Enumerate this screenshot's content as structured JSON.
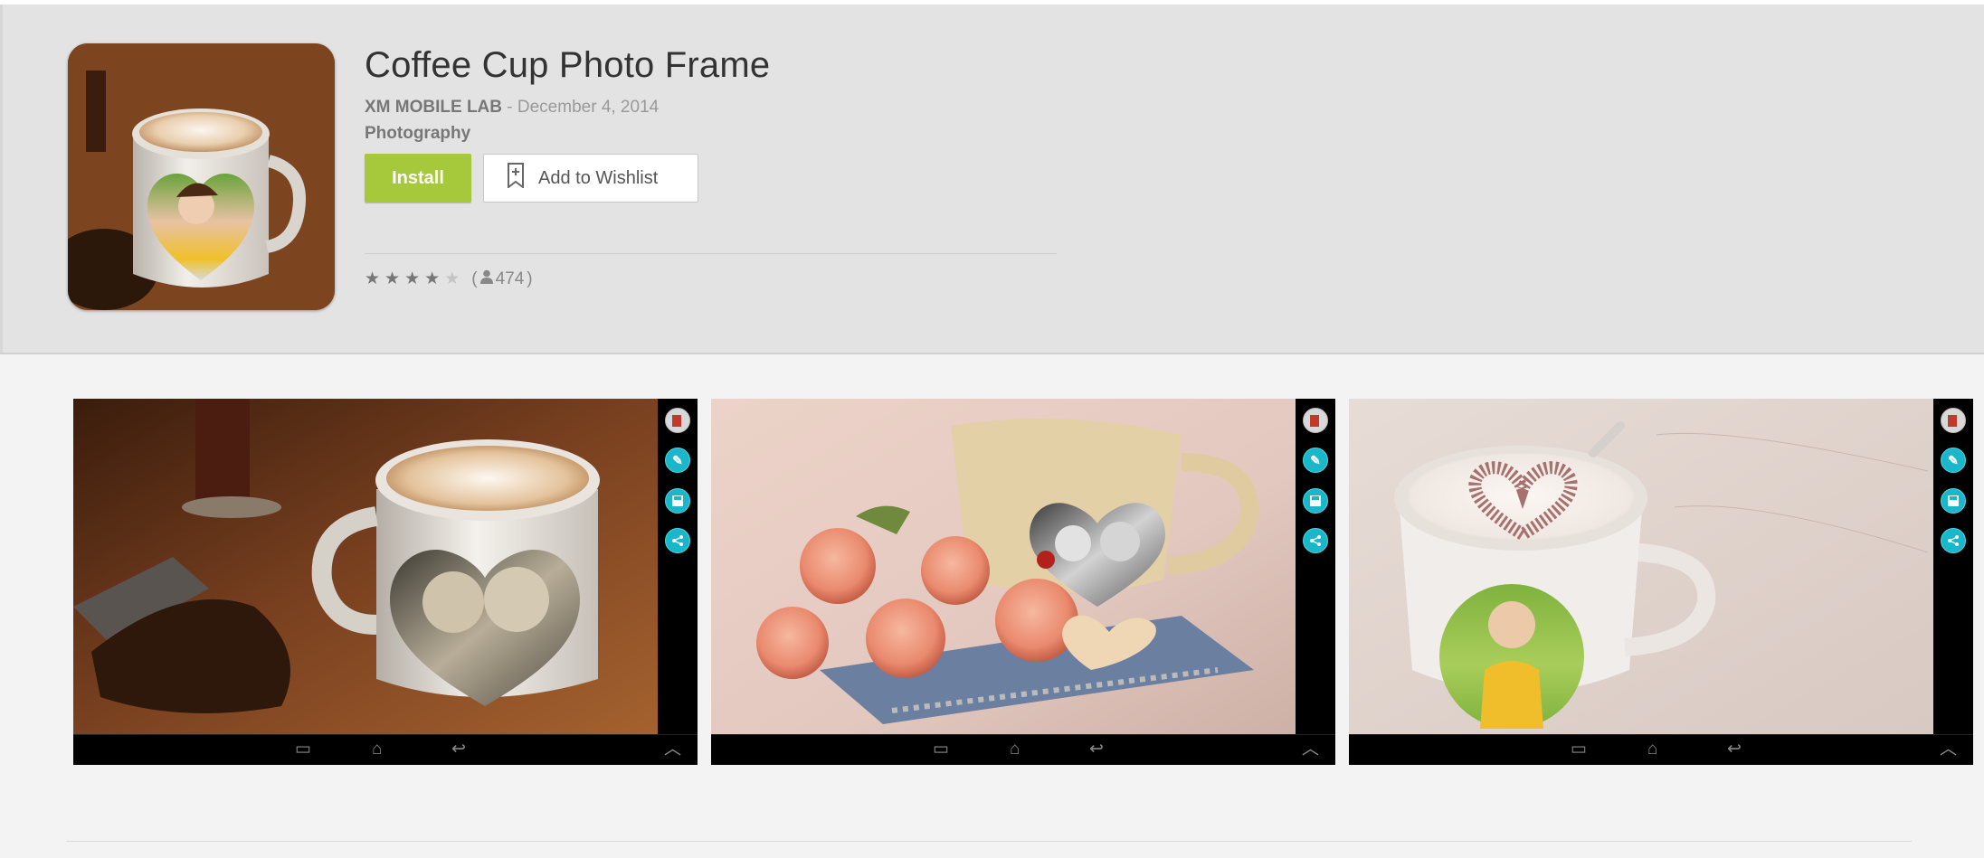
{
  "app": {
    "title": "Coffee Cup Photo Frame",
    "developer": "XM MOBILE LAB",
    "separator": " - ",
    "date": "December 4, 2014",
    "category": "Photography",
    "icon": "coffee-cup-with-heart-photo"
  },
  "actions": {
    "install_label": "Install",
    "wishlist_label": "Add to Wishlist",
    "wishlist_icon": "bookmark-plus-icon",
    "install_color": "#a6c93b"
  },
  "rating": {
    "stars": 4,
    "max_stars": 5,
    "count_prefix": "(",
    "count": "474",
    "count_suffix": ")",
    "person_icon": "person-icon"
  },
  "screenshots": [
    {
      "name": "coffee mug heart frame, sepia kids photo"
    },
    {
      "name": "roses and teacup heart frame, grayscale kids photo"
    },
    {
      "name": "cappuccino cup round frame, girl photo"
    }
  ],
  "colors": {
    "hero_bg": "#e3e3e3",
    "page_bg": "#f3f3f3",
    "accent_teal": "#19b7c9"
  }
}
